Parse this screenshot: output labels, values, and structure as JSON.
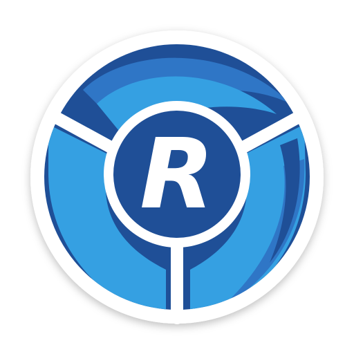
{
  "icon": {
    "name": "app-logo-icon",
    "letter": "R",
    "colors": {
      "background": "#ffffff",
      "outer_ring": "#ffffff",
      "dark_blue": "#1f4f97",
      "mid_blue": "#2f76c6",
      "light_blue": "#35a0e2",
      "spokes": "#ffffff",
      "letter": "#ffffff"
    }
  }
}
